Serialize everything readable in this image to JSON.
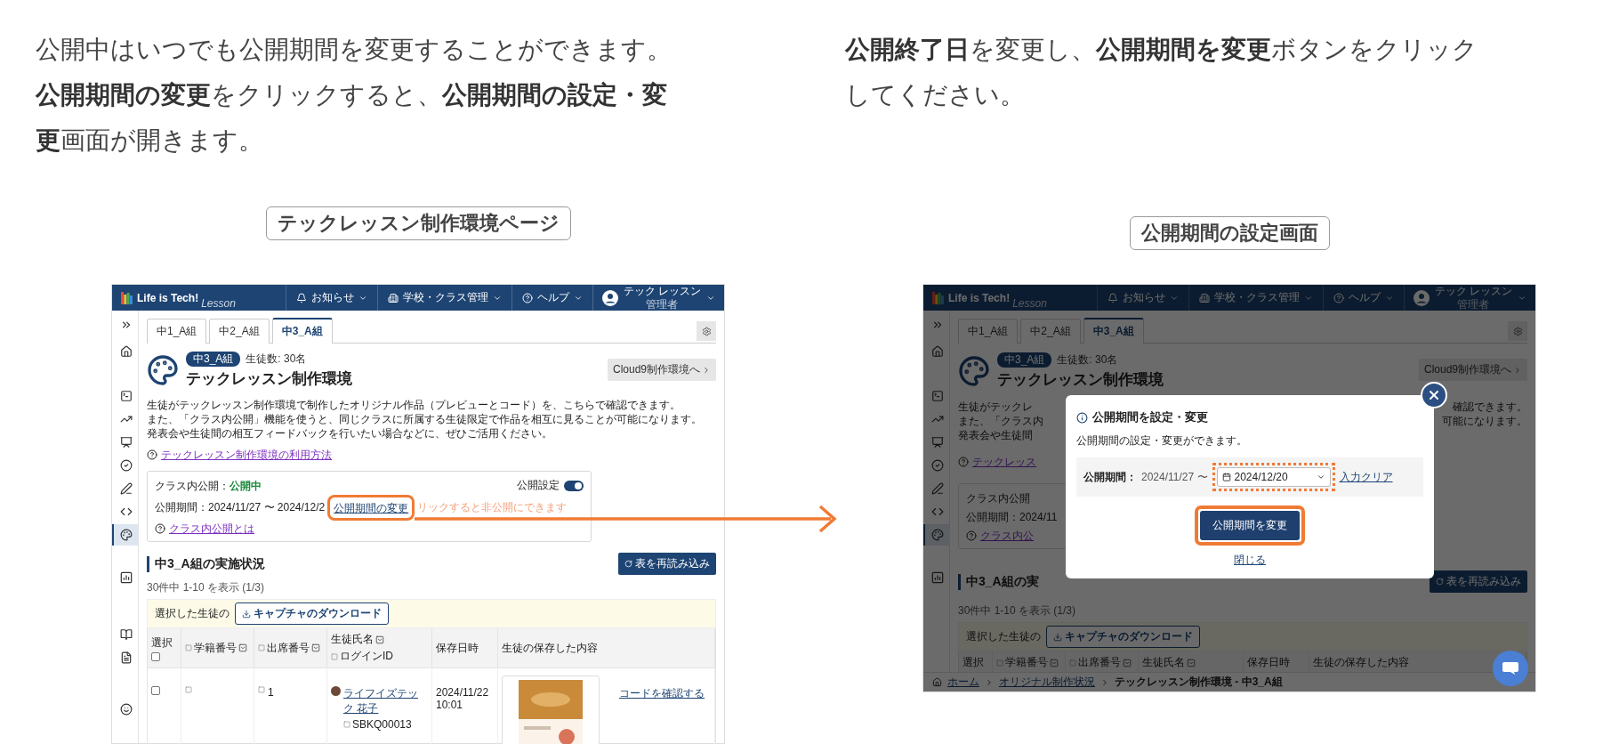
{
  "instructions": [
    {
      "text": "公開中はいつでも公開期間を変更することができます。**公開期間の変更**をクリックすると、**公開期間の設定・変更**画面が開きます。"
    },
    {
      "text": "**公開終了日**を変更し、**公開期間を変更**ボタンをクリックしてください。"
    }
  ],
  "left_panel": {
    "caption": "テックレッスン制作環境ページ",
    "screen": {
      "logo": "Life is Tech!",
      "logo_sub": "Lesson",
      "nav": [
        {
          "label": "お知らせ"
        },
        {
          "label": "学校・クラス管理"
        },
        {
          "label": "ヘルプ"
        }
      ],
      "user": {
        "name": "テック レッスン",
        "role": "管理者"
      },
      "sidebar": [
        {
          "selected": false
        },
        {
          "selected": false
        },
        {
          "selected": false
        },
        {
          "selected": false
        },
        {
          "selected": false
        },
        {
          "selected": false
        },
        {
          "selected": false
        },
        {
          "selected": false
        },
        {
          "selected": true
        },
        {
          "selected": false
        },
        {
          "selected": false
        },
        {
          "selected": false
        },
        {
          "selected": false
        }
      ],
      "tabs": [
        {
          "label": "中1_A組",
          "selected": false
        },
        {
          "label": "中2_A組",
          "selected": false
        },
        {
          "label": "中3_A組",
          "selected": true
        }
      ],
      "class_badge": "中3_A組",
      "student_count": "生徒数: 30名",
      "title": "テックレッスン制作環境",
      "cloud9_button": "Cloud9制作環境へ",
      "description": [
        {
          "text": "生徒がテックレッスン制作環境で制作したオリジナル作品（プレビューとコード）を、こちらで確認できます。"
        },
        {
          "text": "また、「クラス内公開」機能を使うと、同じクラスに所属する生徒限定で作品を相互に見ることが可能になります。"
        },
        {
          "text": "発表会や生徒間の相互フィードバックを行いたい場合などに、ぜひご活用ください。"
        }
      ],
      "help_link": "テックレッスン制作環境の利用方法",
      "publish_card": {
        "title": "クラス内公開：",
        "status": "公開中",
        "toggle_label": "公開設定",
        "toggle_on": true,
        "period": "公開期間：2024/11/27 〜 2024/12/2",
        "change_link": "公開期間の変更",
        "change_link_highlighted": true,
        "hint": "リックすると非公開にできます",
        "help_link": "クラス内公開とは"
      },
      "section": {
        "title": "中3_A組の実施状況",
        "reload_button": "表を再読み込み",
        "count": "30件中 1-10 を表示 (1/3)",
        "selection_label": "選択した生徒の",
        "download_button": "キャプチャのダウンロード"
      },
      "table": {
        "columns": [
          {
            "label": "選択",
            "filter": false
          },
          {
            "label": "学籍番号",
            "filter": true
          },
          {
            "label": "出席番号",
            "filter": true
          },
          {
            "label": "生徒氏名",
            "sub": "ログインID",
            "filter": true
          },
          {
            "label": "保存日時",
            "filter": false
          },
          {
            "label": "生徒の保存した内容",
            "filter": false
          }
        ],
        "select_all": {
          "checked": false
        },
        "rows": [
          {
            "checked": false,
            "attendance_no": "1",
            "name": "ライフイズテック 花子",
            "login_id": "SBKQ00013",
            "saved_at": "2024/11/22 10:01",
            "code_link": "コードを確認する"
          }
        ]
      }
    }
  },
  "right_panel": {
    "caption": "公開期間の設定画面",
    "screen": {
      "logo": "Life is Tech!",
      "logo_sub": "Lesson",
      "nav": [
        {
          "label": "お知らせ"
        },
        {
          "label": "学校・クラス管理"
        },
        {
          "label": "ヘルプ"
        }
      ],
      "user": {
        "name": "テック レッスン",
        "role": "管理者"
      },
      "sidebar": [
        {
          "selected": false
        },
        {
          "selected": false
        },
        {
          "selected": false
        },
        {
          "selected": false
        },
        {
          "selected": false
        },
        {
          "selected": false
        },
        {
          "selected": false
        },
        {
          "selected": false
        },
        {
          "selected": true
        },
        {
          "selected": false
        }
      ],
      "tabs": [
        {
          "label": "中1_A組",
          "selected": false
        },
        {
          "label": "中2_A組",
          "selected": false
        },
        {
          "label": "中3_A組",
          "selected": true
        }
      ],
      "class_badge": "中3_A組",
      "student_count": "生徒数: 30名",
      "title": "テックレッスン制作環境",
      "cloud9_button": "Cloud9制作環境へ",
      "description": [
        {
          "left": "生徒がテックレ",
          "right": "確認できます。"
        },
        {
          "left": "また、「クラス内",
          "right": "可能になります。"
        },
        {
          "left": "発表会や生徒間"
        }
      ],
      "help_link": "テックレッス",
      "publish_card": {
        "title": "クラス内公開",
        "period": "公開期間：2024/11",
        "help_link": "クラス内公"
      },
      "section": {
        "title": "中3_A組の実",
        "reload_button": "表を再読み込み",
        "count": "30件中 1-10 を表示 (1/3)",
        "selection_label": "選択した生徒の",
        "download_button": "キャプチャのダウンロード"
      },
      "table": {
        "columns": [
          {
            "label": "選択",
            "filter": false
          },
          {
            "label": "学籍番号",
            "filter": true
          },
          {
            "label": "出席番号",
            "filter": true
          },
          {
            "label": "生徒氏名",
            "filter": true
          },
          {
            "label": "保存日時",
            "filter": false
          },
          {
            "label": "生徒の保存した内容",
            "filter": false
          }
        ]
      },
      "breadcrumb": [
        {
          "label": "ホーム",
          "kind": "link"
        },
        {
          "label": "オリジナル制作状況",
          "kind": "link"
        },
        {
          "label": "テックレッスン制作環境 - 中3_A組",
          "kind": "current"
        }
      ]
    },
    "dialog": {
      "title": "公開期間を設定・変更",
      "message": "公開期間の設定・変更ができます。",
      "period_label": "公開期間：",
      "start_date": "2024/11/27 〜",
      "end_date": "2024/12/20",
      "end_date_highlighted": true,
      "clear_link": "入力クリア",
      "submit_button": "公開期間を変更",
      "submit_highlighted": true,
      "close_link": "閉じる"
    }
  }
}
